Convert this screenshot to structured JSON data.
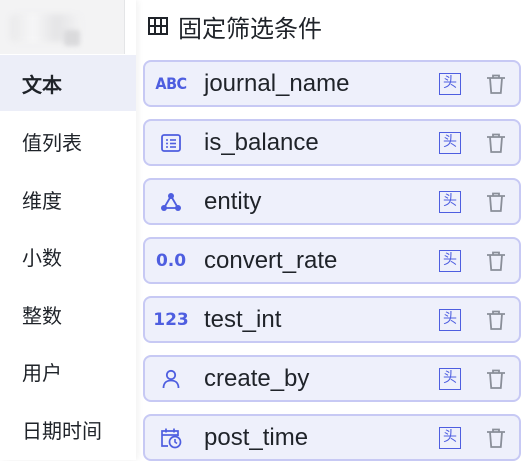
{
  "header": {
    "title": "固定筛选条件",
    "icon": "table-grid-icon"
  },
  "sidebar": {
    "items": [
      {
        "label": "文本",
        "active": true
      },
      {
        "label": "值列表",
        "active": false
      },
      {
        "label": "维度",
        "active": false
      },
      {
        "label": "小数",
        "active": false
      },
      {
        "label": "整数",
        "active": false
      },
      {
        "label": "用户",
        "active": false
      },
      {
        "label": "日期时间",
        "active": false
      }
    ]
  },
  "fields": [
    {
      "name": "journal_name",
      "type_label": "ABC",
      "type_icon": "text-type-icon",
      "head_label": "头"
    },
    {
      "name": "is_balance",
      "type_label": "",
      "type_icon": "value-list-icon",
      "head_label": "头"
    },
    {
      "name": "entity",
      "type_label": "",
      "type_icon": "dimension-icon",
      "head_label": "头"
    },
    {
      "name": "convert_rate",
      "type_label": "0.0",
      "type_icon": "decimal-type-icon",
      "head_label": "头"
    },
    {
      "name": "test_int",
      "type_label": "123",
      "type_icon": "integer-type-icon",
      "head_label": "头"
    },
    {
      "name": "create_by",
      "type_label": "",
      "type_icon": "user-icon",
      "head_label": "头"
    },
    {
      "name": "post_time",
      "type_label": "",
      "type_icon": "calendar-clock-icon",
      "head_label": "头"
    }
  ],
  "colors": {
    "accent": "#4e5ee0",
    "card_background": "#eef0fb",
    "card_border": "#c7c9f4",
    "active_item_background": "#eceef8"
  }
}
